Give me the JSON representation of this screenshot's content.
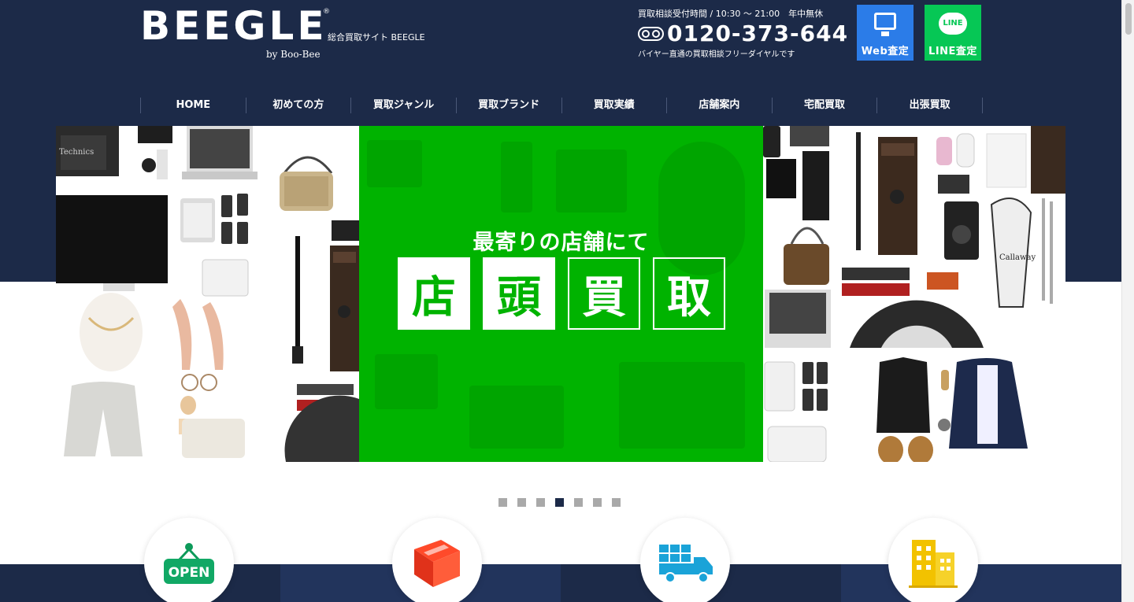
{
  "header": {
    "logo": "BEEGLE",
    "logo_reg": "®",
    "logo_by": "by Boo-Bee",
    "site_desc": "総合買取サイト BEEGLE",
    "hours": "買取相談受付時間 / 10:30 〜 21:00　年中無休",
    "phone": "0120-373-644",
    "phone_note": "バイヤー直通の買取相談フリーダイヤルです",
    "web_button": "Web査定",
    "line_button": "LINE査定",
    "line_logo": "LINE"
  },
  "nav": {
    "items": [
      "HOME",
      "初めての方",
      "買取ジャンル",
      "買取ブランド",
      "買取実績",
      "店舗案内",
      "宅配買取",
      "出張買取"
    ]
  },
  "hero": {
    "subtitle": "最寄りの店舗にて",
    "kanji": [
      "店",
      "頭",
      "買",
      "取"
    ],
    "tile_labels": {
      "technics": "Technics",
      "golf": "Callaway"
    }
  },
  "slider": {
    "count": 7,
    "active_index": 3
  },
  "features": {
    "icons": [
      "open-sign-icon",
      "package-box-icon",
      "delivery-truck-icon",
      "building-icon"
    ],
    "open_label": "OPEN"
  },
  "colors": {
    "navy": "#1c2a48",
    "green": "#00b300",
    "web_blue": "#2b7ce8",
    "line_green": "#06c755"
  }
}
